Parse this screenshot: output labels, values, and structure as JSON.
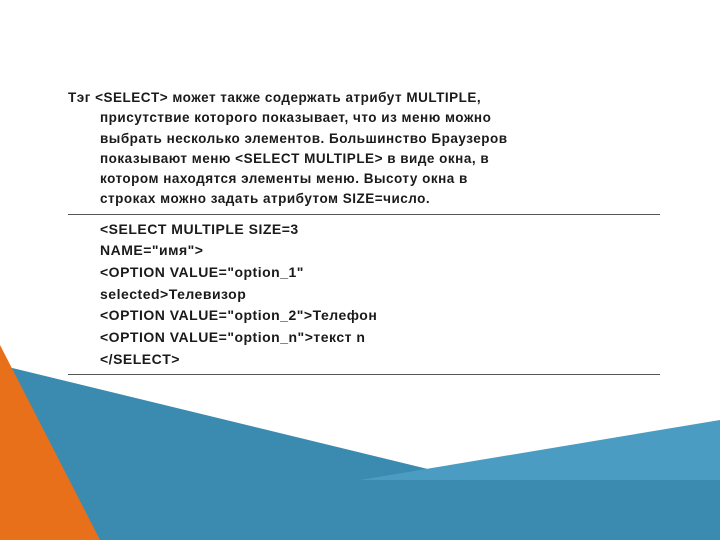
{
  "paragraph": {
    "line1": "Тэг <SELECT> может также содержать атрибут MULTIPLE,",
    "line2": "присутствие которого показывает, что из меню можно",
    "line3": "выбрать несколько элементов. Большинство Браузеров",
    "line4": "показывают меню <SELECT MULTIPLE> в виде окна, в",
    "line5": "котором находятся элементы меню. Высоту окна в",
    "line6": "строках можно задать атрибутом SIZE=число."
  },
  "code": {
    "l1": "<SELECT MULTIPLE SIZE=3",
    "l2": "NAME=\"имя\">",
    "l3": "<OPTION VALUE=\"option_1\"",
    "l4": "selected>Телевизор",
    "l5": "<OPTION VALUE=\"option_2\">Телефон",
    "l6": "<OPTION VALUE=\"option_n\">текст n",
    "l7": "</SELECT>"
  }
}
